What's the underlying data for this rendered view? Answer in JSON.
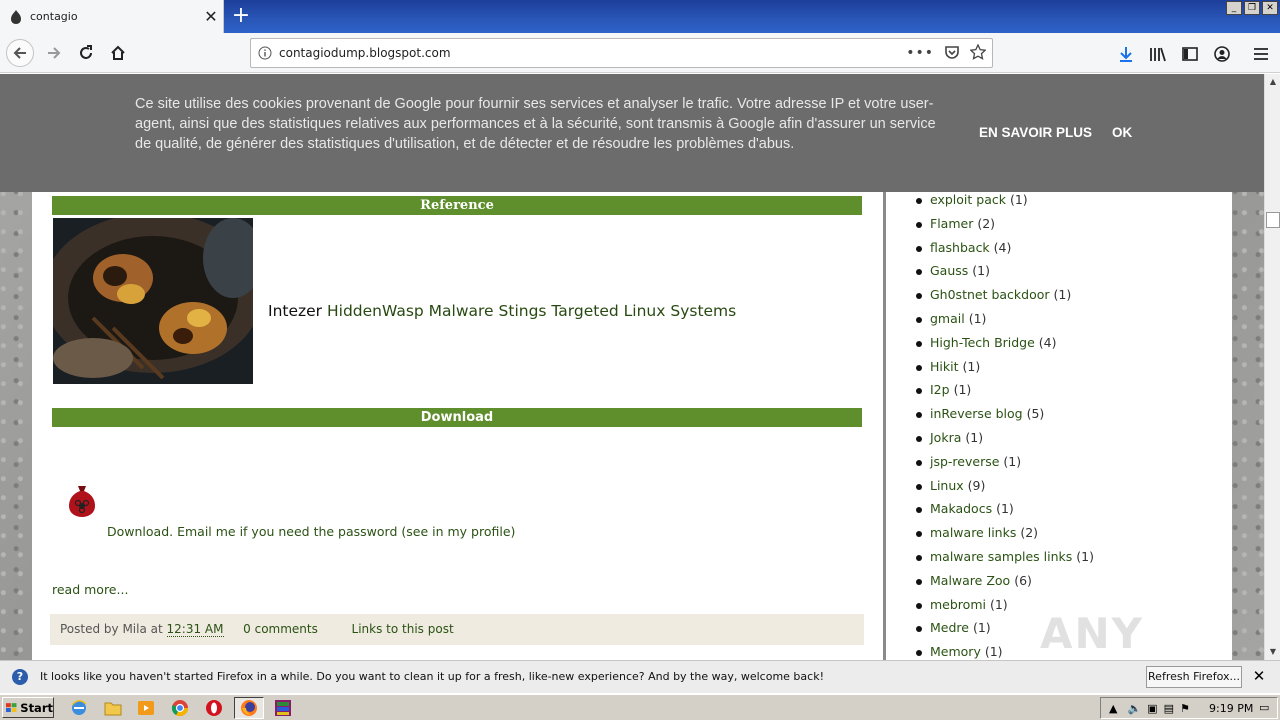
{
  "browser": {
    "tab_title": "contagio",
    "url": "contagiodump.blogspot.com"
  },
  "cookie_banner": {
    "message": "Ce site utilise des cookies provenant de Google pour fournir ses services et analyser le trafic. Votre adresse IP et votre user-agent, ainsi que des statistiques relatives aux performances et à la sécurité, sont transmis à Google afin d'assurer un service de qualité, de générer des statistiques d'utilisation, et de détecter et de résoudre les problèmes d'abus.",
    "learn_more": "EN SAVOIR PLUS",
    "ok": "OK"
  },
  "post": {
    "reference_heading": "Reference",
    "source": "Intezer",
    "article_title": "HiddenWasp Malware Stings Targeted Linux Systems",
    "download_heading": "Download",
    "download_text": "Download. Email me if you need the password (see in my profile)",
    "read_more": "read more...",
    "footer": {
      "posted_by_prefix": "Posted by Mila at",
      "time": "12:31 AM",
      "comments": "0 comments",
      "links": "Links to this post"
    }
  },
  "sidebar": {
    "labels": [
      {
        "name": "exploit pack",
        "count": "(1)"
      },
      {
        "name": "Flamer",
        "count": "(2)"
      },
      {
        "name": "flashback",
        "count": "(4)"
      },
      {
        "name": "Gauss",
        "count": "(1)"
      },
      {
        "name": "Gh0stnet backdoor",
        "count": "(1)"
      },
      {
        "name": "gmail",
        "count": "(1)"
      },
      {
        "name": "High-Tech Bridge",
        "count": "(4)"
      },
      {
        "name": "Hikit",
        "count": "(1)"
      },
      {
        "name": "I2p",
        "count": "(1)"
      },
      {
        "name": "inReverse blog",
        "count": "(5)"
      },
      {
        "name": "Jokra",
        "count": "(1)"
      },
      {
        "name": "jsp-reverse",
        "count": "(1)"
      },
      {
        "name": "Linux",
        "count": "(9)"
      },
      {
        "name": "Makadocs",
        "count": "(1)"
      },
      {
        "name": "malware links",
        "count": "(2)"
      },
      {
        "name": "malware samples links",
        "count": "(1)"
      },
      {
        "name": "Malware Zoo",
        "count": "(6)"
      },
      {
        "name": "mebromi",
        "count": "(1)"
      },
      {
        "name": "Medre",
        "count": "(1)"
      },
      {
        "name": "Memory",
        "count": "(1)"
      }
    ]
  },
  "watermark": "ANY RUN",
  "notification": {
    "text": "It looks like you haven't started Firefox in a while. Do you want to clean it up for a fresh, like-new experience? And by the way, welcome back!",
    "button": "Refresh Firefox..."
  },
  "taskbar": {
    "start": "Start",
    "clock": "9:19 PM"
  }
}
